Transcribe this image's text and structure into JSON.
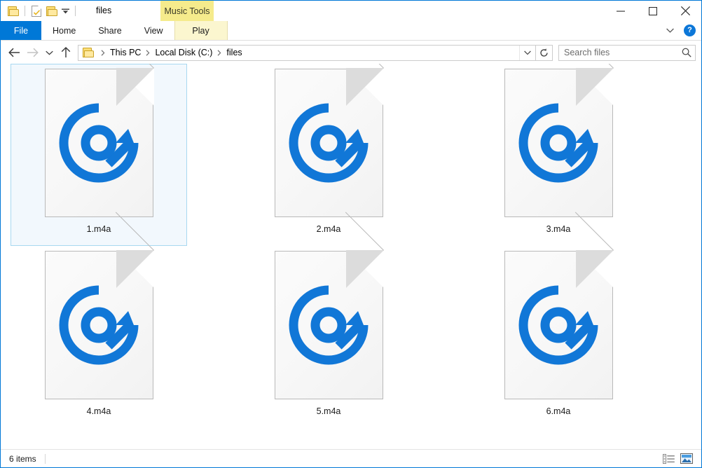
{
  "window": {
    "title": "files",
    "accent_color": "#0078d7",
    "contextual_tab": "Music Tools",
    "controls": {
      "minimize": "Minimize",
      "maximize": "Maximize",
      "close": "Close"
    }
  },
  "quick_access": {
    "items": [
      {
        "name": "folder-icon",
        "label": "Pin to Quick access"
      },
      {
        "name": "properties-icon",
        "label": "Properties"
      },
      {
        "name": "new-folder-icon",
        "label": "New folder"
      },
      {
        "name": "customize-dropdown-icon",
        "label": "Customize Quick Access Toolbar"
      }
    ]
  },
  "ribbon": {
    "tabs": [
      {
        "label": "File",
        "active": false,
        "style": "file"
      },
      {
        "label": "Home",
        "active": false,
        "style": "normal"
      },
      {
        "label": "Share",
        "active": false,
        "style": "normal"
      },
      {
        "label": "View",
        "active": false,
        "style": "normal"
      },
      {
        "label": "Play",
        "active": true,
        "style": "contextual"
      }
    ],
    "expand_label": "Expand the Ribbon",
    "help_label": "?"
  },
  "address_bar": {
    "back_label": "Back",
    "forward_label": "Forward",
    "recent_label": "Recent locations",
    "up_label": "Up",
    "breadcrumbs": [
      "This PC",
      "Local Disk (C:)",
      "files"
    ],
    "dropdown_label": "Previous locations",
    "refresh_label": "Refresh"
  },
  "search": {
    "placeholder": "Search files",
    "value": "",
    "icon": "search-icon"
  },
  "files": [
    {
      "name": "1.m4a",
      "type": "m4a",
      "selected": true
    },
    {
      "name": "2.m4a",
      "type": "m4a",
      "selected": false
    },
    {
      "name": "3.m4a",
      "type": "m4a",
      "selected": false
    },
    {
      "name": "4.m4a",
      "type": "m4a",
      "selected": false
    },
    {
      "name": "5.m4a",
      "type": "m4a",
      "selected": false
    },
    {
      "name": "6.m4a",
      "type": "m4a",
      "selected": false
    }
  ],
  "file_icon": {
    "name": "music-disc-icon",
    "disc_color": "#1177d7"
  },
  "status_bar": {
    "item_count": "6 items",
    "views": [
      {
        "name": "details-view-button",
        "label": "Details view",
        "active": false
      },
      {
        "name": "large-icons-view-button",
        "label": "Large icons view",
        "active": true
      }
    ]
  }
}
